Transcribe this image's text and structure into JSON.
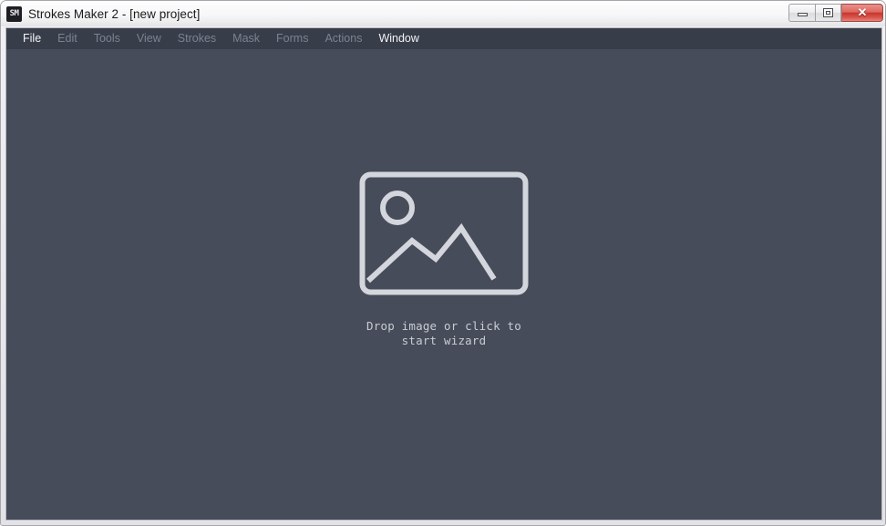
{
  "window": {
    "title": "Strokes Maker 2 - [new project]",
    "app_icon": "app-logo-icon",
    "controls": {
      "minimize_label": "Minimize",
      "maximize_label": "Restore",
      "close_label": "✕"
    },
    "colors": {
      "titlebar_bg": "#f7f7f9",
      "menubar_bg": "#383d4a",
      "content_bg": "#474c5a",
      "menu_text_enabled": "#f2f3f6",
      "menu_text_disabled": "#7d8292",
      "placeholder_stroke": "#d3d6dc",
      "close_button": "#c9352c"
    }
  },
  "menubar": {
    "items": [
      {
        "label": "File",
        "enabled": true
      },
      {
        "label": "Edit",
        "enabled": false
      },
      {
        "label": "Tools",
        "enabled": false
      },
      {
        "label": "View",
        "enabled": false
      },
      {
        "label": "Strokes",
        "enabled": false
      },
      {
        "label": "Mask",
        "enabled": false
      },
      {
        "label": "Forms",
        "enabled": false
      },
      {
        "label": "Actions",
        "enabled": false
      },
      {
        "label": "Window",
        "enabled": true
      }
    ]
  },
  "dropzone": {
    "icon": "image-placeholder-icon",
    "text": "Drop image or click to\nstart wizard"
  }
}
